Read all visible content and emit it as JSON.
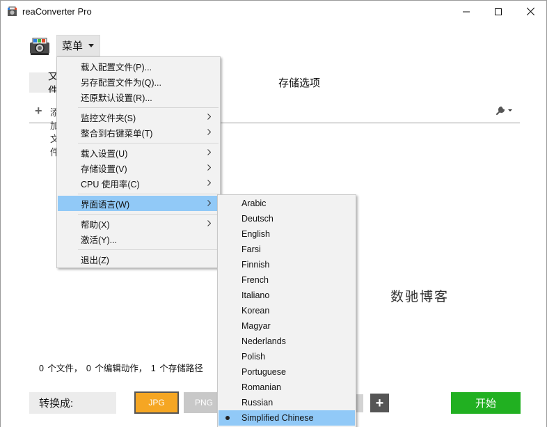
{
  "window": {
    "title": "reaConverter Pro"
  },
  "menu_button": {
    "label": "菜单"
  },
  "tabs": {
    "files_label": "文件",
    "save_options_label": "存储选项"
  },
  "add_row": {
    "add_label": "添加文件"
  },
  "watermark": "数驰博客",
  "status_text": "0 个文件， 0 个编辑动作， 1 个存储路径",
  "bottom": {
    "convert_label": "转换成:",
    "formats": [
      "JPG",
      "PNG"
    ],
    "add_format": "+",
    "start_label": "开始",
    "colors": {
      "active_format": "#f5a623",
      "start": "#21b021"
    }
  },
  "main_menu": {
    "items": [
      {
        "label": "载入配置文件(P)...",
        "submenu": false
      },
      {
        "label": "另存配置文件为(Q)...",
        "submenu": false
      },
      {
        "label": "还原默认设置(R)...",
        "submenu": false
      },
      {
        "label": "监控文件夹(S)",
        "submenu": true
      },
      {
        "label": "整合到右键菜单(T)",
        "submenu": true
      },
      {
        "label": "载入设置(U)",
        "submenu": true
      },
      {
        "label": "存储设置(V)",
        "submenu": true
      },
      {
        "label": "CPU 使用率(C)",
        "submenu": true
      },
      {
        "label": "界面语言(W)",
        "submenu": true,
        "highlighted": true
      },
      {
        "label": "帮助(X)",
        "submenu": true
      },
      {
        "label": "激活(Y)...",
        "submenu": false
      },
      {
        "label": "退出(Z)",
        "submenu": false
      }
    ],
    "highlight_color": "#91c9f7"
  },
  "language_menu": {
    "items": [
      "Arabic",
      "Deutsch",
      "English",
      "Farsi",
      "Finnish",
      "French",
      "Italiano",
      "Korean",
      "Magyar",
      "Nederlands",
      "Polish",
      "Portuguese",
      "Romanian",
      "Russian",
      "Simplified Chinese"
    ],
    "selected": "Simplified Chinese"
  }
}
